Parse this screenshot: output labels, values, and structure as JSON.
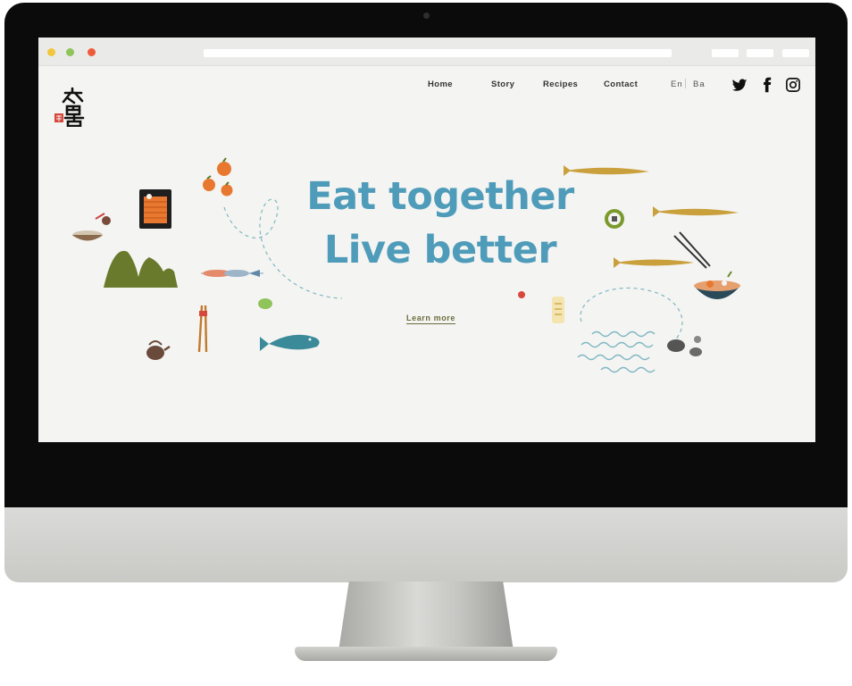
{
  "browser": {
    "traffic_lights": [
      "#f2c53d",
      "#8fc45a",
      "#ee5a3a"
    ]
  },
  "site": {
    "logo_text": "吾吉",
    "nav": [
      {
        "label": "Home"
      },
      {
        "label": "Story"
      },
      {
        "label": "Recipes"
      },
      {
        "label": "Contact"
      }
    ],
    "language": {
      "primary": "En",
      "secondary": "Ba"
    },
    "social_icons": [
      "twitter-icon",
      "facebook-icon",
      "instagram-icon"
    ]
  },
  "hero": {
    "headline_line1": "Eat together",
    "headline_line2": "Live better",
    "cta_label": "Learn more"
  },
  "colors": {
    "headline": "#4f9cba",
    "cta": "#6a6d3c",
    "page_background": "#f4f4f2",
    "fish_gold": "#c9a03c",
    "orange": "#e8782f",
    "mountain_green": "#6a7a2c",
    "teal_fish": "#3a8a9a"
  }
}
